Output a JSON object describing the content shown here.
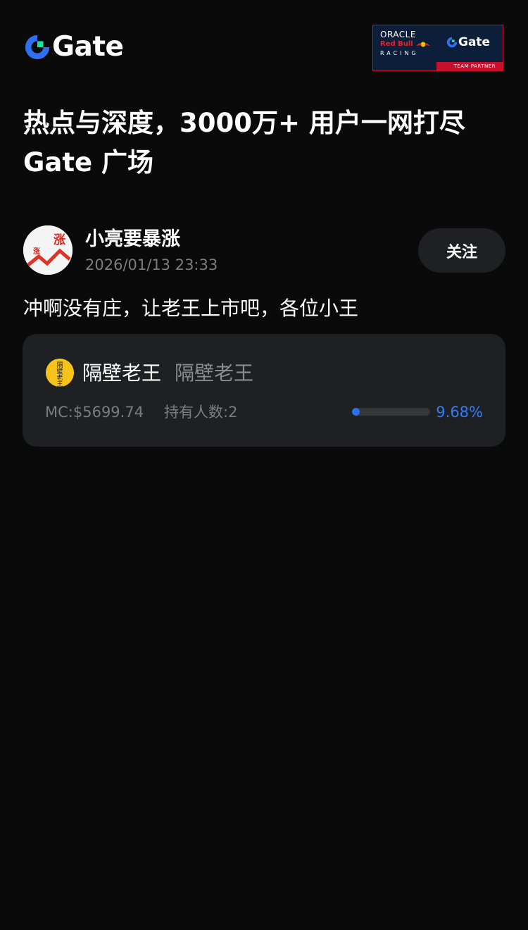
{
  "header": {
    "logo_text": "Gate",
    "partner": {
      "oracle": "ORACLE",
      "redbull": "Red Bull",
      "racing": "RACING",
      "gate": "Gate",
      "strip": "TEAM PARTNER"
    }
  },
  "headline": {
    "line1": "热点与深度，3000万+ 用户一网打尽",
    "line2": "Gate 广场"
  },
  "post": {
    "avatar_char_big": "涨",
    "avatar_char_small": "涨",
    "username": "小亮要暴涨",
    "timestamp": "2026/01/13 23:33",
    "follow_label": "关注",
    "content": "冲啊没有庄，让老王上市吧，各位小王"
  },
  "token": {
    "icon_chars": [
      "隔",
      "壁",
      "老",
      "王"
    ],
    "name": "隔壁老王",
    "symbol": "隔壁老王",
    "market_cap": "MC:$5699.74",
    "holders": "持有人数:2",
    "progress_text": "9.68%",
    "progress_value": 0.0968
  },
  "colors": {
    "background": "#0a0a0a",
    "brand_blue": "#2f6ff2",
    "brand_green": "#17e6a1",
    "card": "#1f2023",
    "muted": "#7c7c7f"
  }
}
